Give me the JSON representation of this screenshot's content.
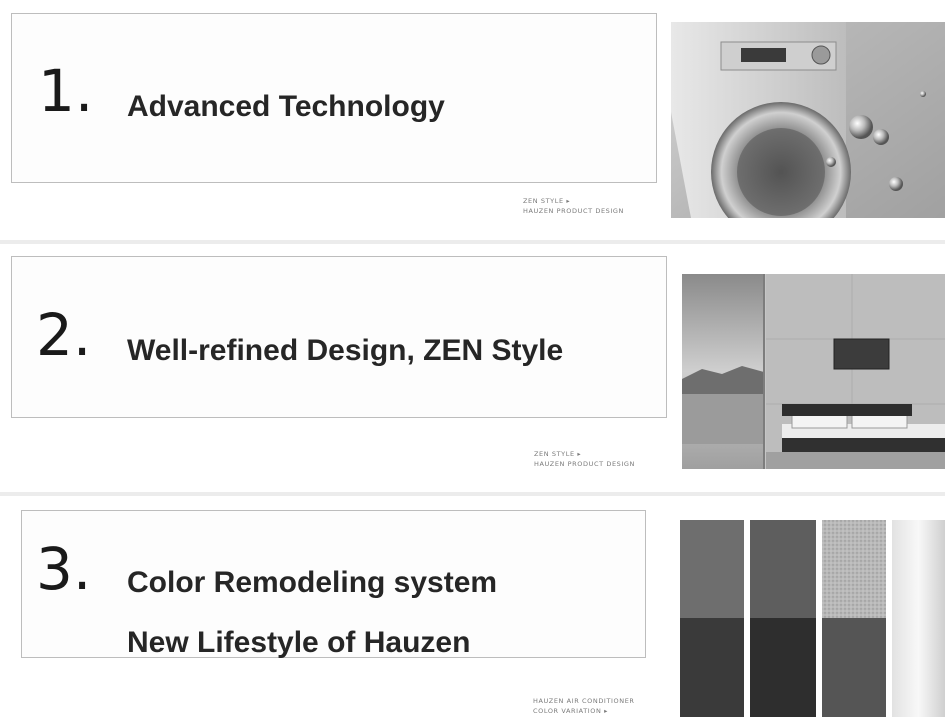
{
  "items": [
    {
      "number": "1.",
      "headline": [
        "Advanced Technology"
      ],
      "caption": [
        "ZEN STYLE ▸",
        "HAUZEN PRODUCT DESIGN"
      ],
      "photo": "washing-machine-photo"
    },
    {
      "number": "2.",
      "headline": [
        "Well-refined Design, ZEN Style"
      ],
      "caption": [
        "ZEN STYLE ▸",
        "HAUZEN PRODUCT DESIGN"
      ],
      "photo": "bedroom-interior-photo"
    },
    {
      "number": "3.",
      "headline": [
        "Color Remodeling system",
        "New Lifestyle of Hauzen"
      ],
      "caption": [
        "HAUZEN AIR CONDITIONER",
        "COLOR VARIATION ▸"
      ],
      "photo": "color-swatch-panels-photo"
    }
  ]
}
